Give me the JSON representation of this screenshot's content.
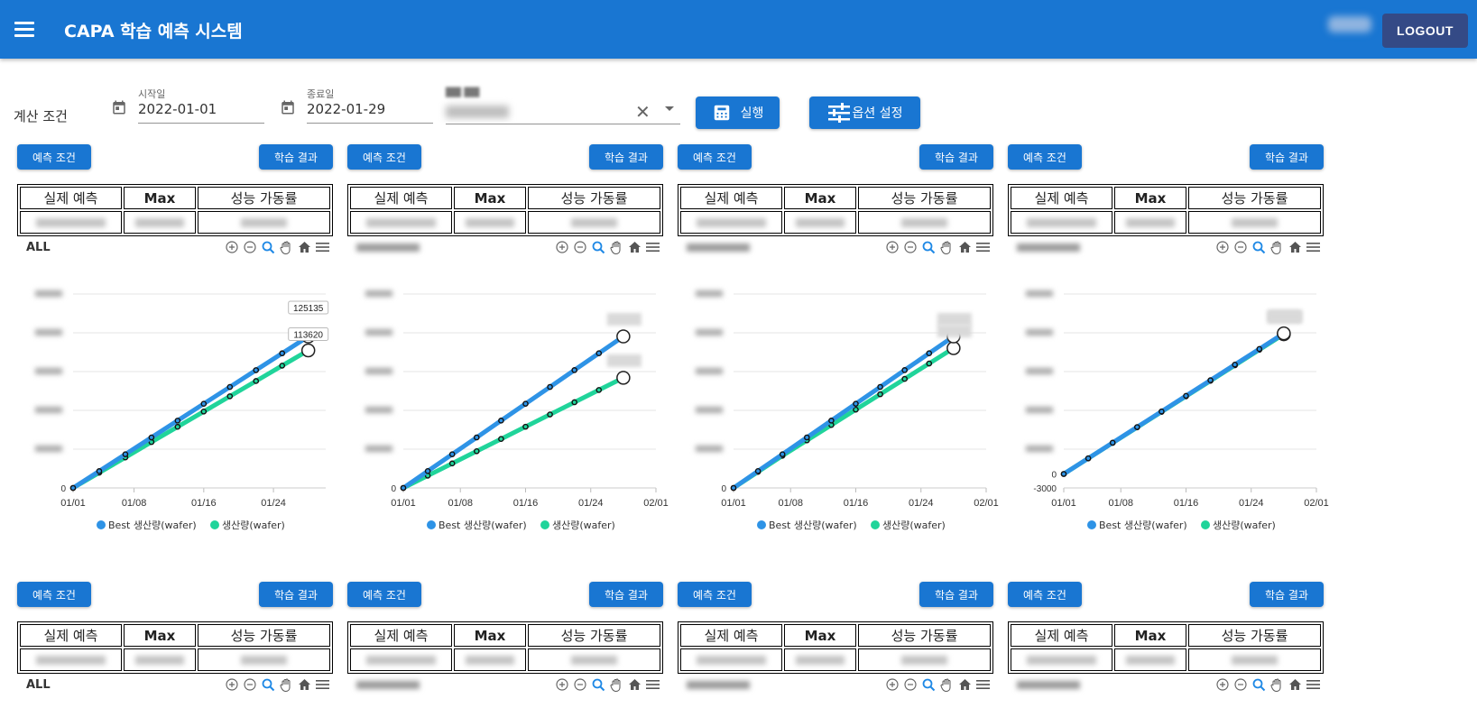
{
  "header": {
    "title": "CAPA 학습 예측 시스템",
    "logout_label": "LOGOUT"
  },
  "filters": {
    "condition_label": "계산 조건",
    "start": {
      "label": "시작일",
      "value": "2022-01-01"
    },
    "end": {
      "label": "종료일",
      "value": "2022-01-29"
    },
    "run_label": "실행",
    "options_label": "옵션 설정"
  },
  "panel_common": {
    "predict_btn": "예측 조건",
    "learn_btn": "학습 결과",
    "col_actual": "실제 예측",
    "col_max": "Max",
    "col_rate": "성능 가동률"
  },
  "colors": {
    "primary": "#1976d2",
    "logout": "#344a86",
    "best_series": "#2e93e6",
    "actual_series": "#20d49a"
  },
  "icons": [
    "menu-icon",
    "calendar-icon",
    "clear-icon",
    "dropdown-caret-icon",
    "calculator-icon",
    "sliders-icon",
    "zoom-in-icon",
    "zoom-out-icon",
    "selection-zoom-icon",
    "pan-hand-icon",
    "home-reset-icon",
    "chart-menu-icon"
  ],
  "panels": [
    {
      "name": "ALL"
    },
    {
      "name": ""
    },
    {
      "name": ""
    },
    {
      "name": ""
    }
  ],
  "chart_data": [
    {
      "type": "line",
      "x": [
        "01/01",
        "01/04",
        "01/07",
        "01/10",
        "01/13",
        "01/16",
        "01/19",
        "01/22",
        "01/25",
        "01/28"
      ],
      "series": [
        {
          "name": "Best 생산량(wafer)",
          "values": [
            0,
            13900,
            27800,
            41700,
            55600,
            69500,
            83400,
            97300,
            111200,
            125135
          ]
        },
        {
          "name": "생산량(wafer)",
          "values": [
            0,
            12600,
            25200,
            37900,
            50500,
            63100,
            75700,
            88300,
            101000,
            113620
          ]
        }
      ],
      "x_ticks": [
        "01/01",
        "01/08",
        "01/16",
        "01/24"
      ],
      "y_ticks": [
        "0"
      ],
      "annotations": [
        "125135",
        "113620"
      ],
      "legend": "bottom"
    },
    {
      "type": "line",
      "x": [
        "01/01",
        "01/04",
        "01/07",
        "01/10",
        "01/13",
        "01/16",
        "01/19",
        "01/22",
        "01/25",
        "01/28"
      ],
      "series": [
        {
          "name": "Best 생산량(wafer)",
          "values": [
            0,
            11,
            22,
            33,
            44,
            55,
            66,
            77,
            88,
            99
          ]
        },
        {
          "name": "생산량(wafer)",
          "values": [
            0,
            8,
            16,
            24,
            32,
            40,
            48,
            56,
            64,
            72
          ]
        }
      ],
      "x_ticks": [
        "01/01",
        "01/08",
        "01/16",
        "01/24",
        "02/01"
      ],
      "y_ticks": [
        "0"
      ],
      "legend": "bottom"
    },
    {
      "type": "line",
      "x": [
        "01/01",
        "01/04",
        "01/07",
        "01/10",
        "01/13",
        "01/16",
        "01/19",
        "01/22",
        "01/25",
        "01/28"
      ],
      "series": [
        {
          "name": "Best 생산량(wafer)",
          "values": [
            0,
            11.5,
            23,
            34.5,
            46,
            57.5,
            69,
            80.5,
            92,
            103.5
          ]
        },
        {
          "name": "생산량(wafer)",
          "values": [
            0,
            11,
            22,
            32.5,
            43,
            53.5,
            64,
            74.5,
            85,
            95.5
          ]
        }
      ],
      "x_ticks": [
        "01/01",
        "01/08",
        "01/16",
        "01/24",
        "02/01"
      ],
      "y_ticks": [
        "0"
      ],
      "legend": "bottom"
    },
    {
      "type": "line",
      "x": [
        "01/01",
        "01/04",
        "01/07",
        "01/10",
        "01/13",
        "01/16",
        "01/19",
        "01/22",
        "01/25",
        "01/28"
      ],
      "series": [
        {
          "name": "Best 생산량(wafer)",
          "values": [
            0,
            3350,
            6700,
            10050,
            13400,
            16750,
            20100,
            23450,
            26800,
            30150
          ]
        },
        {
          "name": "생산량(wafer)",
          "values": [
            0,
            3330,
            6660,
            9990,
            13320,
            16650,
            19980,
            23310,
            26640,
            29970
          ]
        }
      ],
      "x_ticks": [
        "01/01",
        "01/08",
        "01/16",
        "01/24",
        "02/01"
      ],
      "y_ticks": [
        "0",
        "-3000"
      ],
      "legend": "bottom"
    }
  ]
}
